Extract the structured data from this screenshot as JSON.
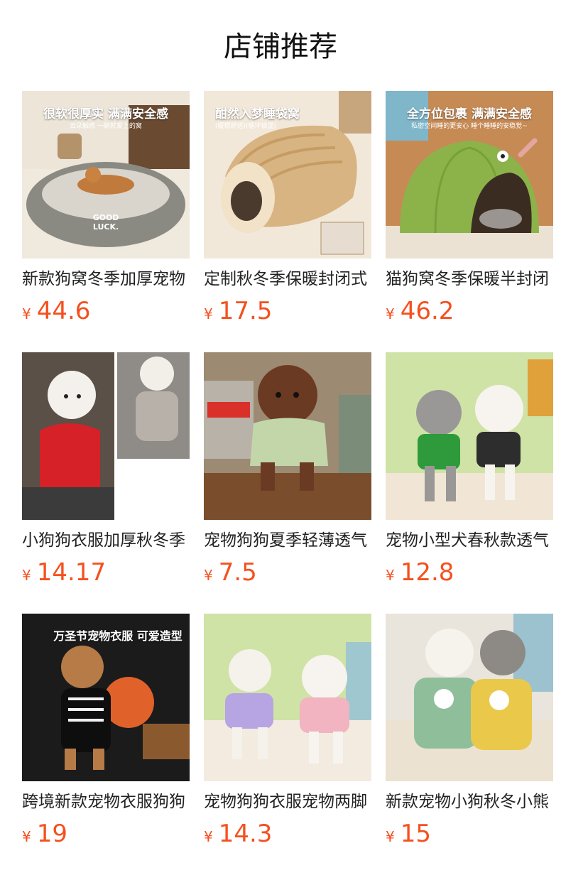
{
  "section_title": "店铺推荐",
  "products": [
    {
      "name": "新款狗窝冬季加厚宠物",
      "currency": "¥",
      "price": "44.6",
      "caption": "很软很厚实 满满安全感",
      "subcaption": "云朵触感 一躺就爱上的窝",
      "bg": "#e7dcc9",
      "accent": "#7a7a74"
    },
    {
      "name": "定制秋冬季保暖封闭式",
      "currency": "¥",
      "price": "17.5",
      "caption": "酣然入梦睡袋窝",
      "subcaption": "(暖糯舒适)(循环锁温)",
      "bg": "#efe3d2",
      "accent": "#d8b077"
    },
    {
      "name": "猫狗窝冬季保暖半封闭",
      "currency": "¥",
      "price": "46.2",
      "caption": "全方位包裹 满满安全感",
      "subcaption": "私密空间睡的更安心 睡个睡睡的安稳觉~",
      "bg": "#c98e5a",
      "accent": "#8cb34a"
    },
    {
      "name": "小狗狗衣服加厚秋冬季",
      "currency": "¥",
      "price": "14.17",
      "caption": "",
      "subcaption": "",
      "bg": "#6b6158",
      "accent": "#d72128"
    },
    {
      "name": "宠物狗狗夏季轻薄透气",
      "currency": "¥",
      "price": "7.5",
      "caption": "",
      "subcaption": "",
      "bg": "#b8a48c",
      "accent": "#c3d6a9"
    },
    {
      "name": "宠物小型犬春秋款透气",
      "currency": "¥",
      "price": "12.8",
      "caption": "",
      "subcaption": "",
      "bg": "#d7e8b7",
      "accent": "#2d2d2d"
    },
    {
      "name": "跨境新款宠物衣服狗狗",
      "currency": "¥",
      "price": "19",
      "caption": "万圣节宠物衣服 可爱造型",
      "subcaption": "",
      "bg": "#1f1f1f",
      "accent": "#e0622a"
    },
    {
      "name": "宠物狗狗衣服宠物两脚",
      "currency": "¥",
      "price": "14.3",
      "caption": "",
      "subcaption": "",
      "bg": "#cfe3a6",
      "accent": "#f1b4c0"
    },
    {
      "name": "新款宠物小狗秋冬小熊",
      "currency": "¥",
      "price": "15",
      "caption": "",
      "subcaption": "",
      "bg": "#ece8e2",
      "accent": "#eac94a"
    }
  ]
}
